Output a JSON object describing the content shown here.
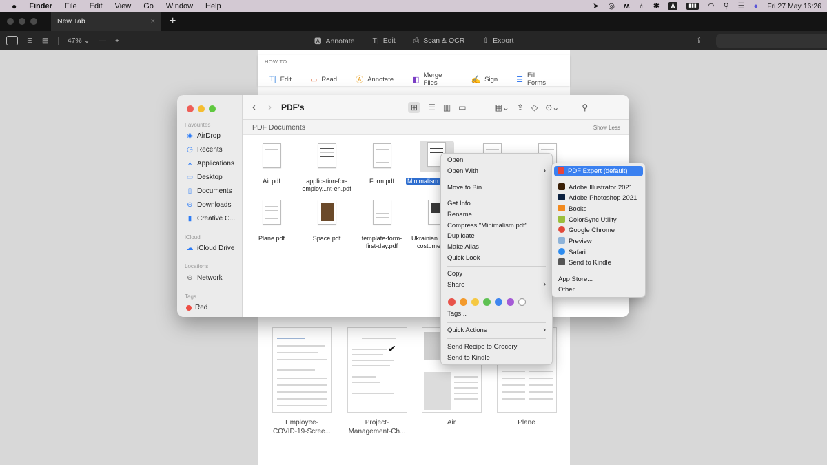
{
  "menubar": {
    "apple": "",
    "app": "Finder",
    "items": [
      "File",
      "Edit",
      "View",
      "Go",
      "Window",
      "Help"
    ],
    "datetime": "Fri 27 May  16:26",
    "kb_label": "A"
  },
  "browser": {
    "tab_title": "New Tab",
    "tab_close": "×",
    "new_tab": "+"
  },
  "toolbar": {
    "zoom": "47% ⌄",
    "minus": "—",
    "plus": "+",
    "annotate": "Annotate",
    "edit": "Edit",
    "scan_ocr": "Scan & OCR",
    "export": "Export"
  },
  "howto": {
    "label": "HOW TO",
    "items": [
      {
        "label": "Edit",
        "color": "#4a90e2"
      },
      {
        "label": "Read",
        "color": "#e0663a"
      },
      {
        "label": "Annotate",
        "color": "#e8a020"
      },
      {
        "label": "Merge Files",
        "color": "#7b3fc6"
      },
      {
        "label": "Sign",
        "color": "#8a3fd0"
      },
      {
        "label": "Fill Forms",
        "color": "#3c7ef0"
      }
    ]
  },
  "thumbnails": [
    {
      "caption_1": "Employee-",
      "caption_2": "COVID-19-Scree..."
    },
    {
      "caption_1": "Project-",
      "caption_2": "Management-Ch..."
    },
    {
      "caption_1": "Air",
      "caption_2": ""
    },
    {
      "caption_1": "Plane",
      "caption_2": ""
    }
  ],
  "finder": {
    "title": "PDF's",
    "section": "PDF Documents",
    "show_less": "Show Less",
    "sidebar": {
      "favourites_label": "Favourites",
      "favourites": [
        "AirDrop",
        "Recents",
        "Applications",
        "Desktop",
        "Documents",
        "Downloads",
        "Creative C..."
      ],
      "icloud_label": "iCloud",
      "icloud": [
        "iCloud Drive"
      ],
      "locations_label": "Locations",
      "locations": [
        "Network"
      ],
      "tags_label": "Tags",
      "tags": [
        "Red"
      ]
    },
    "files": [
      {
        "name_1": "Air.pdf",
        "name_2": ""
      },
      {
        "name_1": "application-for-",
        "name_2": "employ...nt-en.pdf"
      },
      {
        "name_1": "Form.pdf",
        "name_2": ""
      },
      {
        "name_1": "Minimalism.pdf",
        "name_2": ""
      },
      {
        "name_1": "Plane.pdf",
        "name_2": ""
      },
      {
        "name_1": "Space.pdf",
        "name_2": ""
      },
      {
        "name_1": "template-form-",
        "name_2": "first-day.pdf"
      },
      {
        "name_1": "Ukrainian",
        "name_2": "costume"
      }
    ]
  },
  "context_menu": {
    "open": "Open",
    "open_with": "Open With",
    "move_to_bin": "Move to Bin",
    "get_info": "Get Info",
    "rename": "Rename",
    "compress": "Compress \"Minimalism.pdf\"",
    "duplicate": "Duplicate",
    "make_alias": "Make Alias",
    "quick_look": "Quick Look",
    "copy": "Copy",
    "share": "Share",
    "tags": "Tags...",
    "quick_actions": "Quick Actions",
    "send_recipe": "Send Recipe to Grocery",
    "send_kindle": "Send to Kindle",
    "tag_colors": [
      "#e8534a",
      "#f39a2d",
      "#f5c842",
      "#5ec152",
      "#3f86ef",
      "#a55bd6",
      "#ffffff"
    ]
  },
  "open_with_menu": {
    "default": "PDF Expert (default)",
    "apps": [
      {
        "label": "Adobe Illustrator 2021",
        "color": "#3a1f06"
      },
      {
        "label": "Adobe Photoshop 2021",
        "color": "#0b2140"
      },
      {
        "label": "Books",
        "color": "#f28a1e"
      },
      {
        "label": "ColorSync Utility",
        "color": "#9bbf3c"
      },
      {
        "label": "Google Chrome",
        "color": "#e2493a"
      },
      {
        "label": "Preview",
        "color": "#8eb3d9"
      },
      {
        "label": "Safari",
        "color": "#2d8cf0"
      },
      {
        "label": "Send to Kindle",
        "color": "#555555"
      }
    ],
    "app_store": "App Store...",
    "other": "Other..."
  }
}
